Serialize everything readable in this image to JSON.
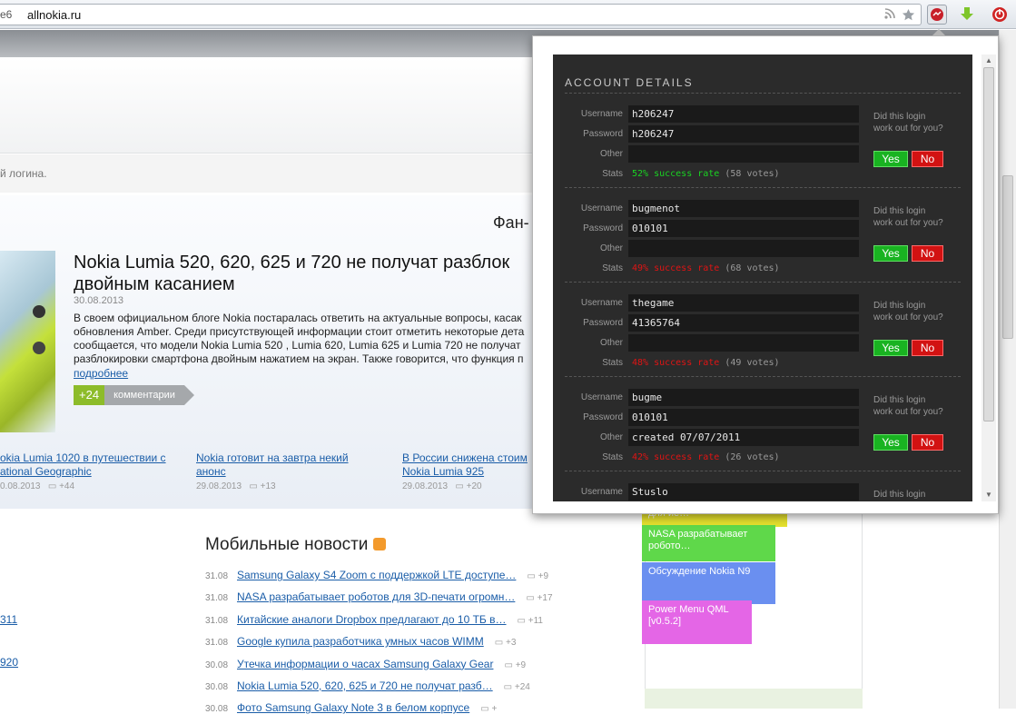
{
  "browser": {
    "tab_fragment": "е6",
    "url": "allnokia.ru",
    "icons": [
      "rss-icon",
      "star-icon",
      "account-extension-icon",
      "download-arrow-icon",
      "shutdown-icon"
    ]
  },
  "page": {
    "login_hint": "й логина.",
    "fan_heading": "Фан-",
    "feature": {
      "title_line1": "Nokia Lumia 520, 620, 625 и 720 не получат разблок",
      "title_line2": "двойным касанием",
      "date": "30.08.2013",
      "body_lines": [
        "В своем официальном блоге Nokia постаралась ответить на актуальные вопросы, касак",
        "обновления Amber. Среди присутствующей информации стоит отметить некоторые дета",
        "сообщается, что модели Nokia Lumia 520 , Lumia 620, Lumia 625 и Lumia 720 не получат",
        "разблокировки смартфона двойным нажатием на экран. Также говорится, что функция п"
      ],
      "more": "подробнее",
      "comments_count": "+24",
      "comments_label": "комментарии"
    },
    "sub_news": [
      {
        "title": "okia Lumia 1020 в путешествии с ational Geographic",
        "date": "0.08.2013",
        "comments": "+44"
      },
      {
        "title": "Nokia готовит на завтра некий анонс",
        "date": "29.08.2013",
        "comments": "+13"
      },
      {
        "title": "В России снижена стоим Nokia Lumia 925",
        "date": "29.08.2013",
        "comments": "+20"
      }
    ],
    "mobile_news_title": "Мобильные новости",
    "mobile_news": [
      {
        "date": "31.08",
        "title": "Samsung Galaxy S4 Zoom с поддержкой LTE доступе…",
        "comments": "+9"
      },
      {
        "date": "31.08",
        "title": "NASA разрабатывает роботов для 3D-печати огромн…",
        "comments": "+17"
      },
      {
        "date": "31.08",
        "title": "Китайские аналоги Dropbox предлагают до 10 ТБ в…",
        "comments": "+11"
      },
      {
        "date": "31.08",
        "title": "Google купила разработчика умных часов WIMM",
        "comments": "+3"
      },
      {
        "date": "30.08",
        "title": "Утечка информации о часах Samsung Galaxy Gear",
        "comments": "+9"
      },
      {
        "date": "30.08",
        "title": "Nokia Lumia 520, 620, 625 и 720 не получат разб…",
        "comments": "+24"
      },
      {
        "date": "30.08",
        "title": "Фото Samsung Galaxy Note 3 в белом корпусе",
        "comments": "+"
      }
    ],
    "left_links": [
      "311",
      "920"
    ],
    "tags": [
      {
        "text": "для ие…",
        "color": "#e6e22e"
      },
      {
        "text": "NASA разрабатывает робото…",
        "color": "#5fd84a"
      },
      {
        "text": "Обсуждение Nokia N9",
        "color": "#6a8ff0"
      },
      {
        "text": "Power Menu QML [v0.5.2]",
        "color": "#e466e6"
      }
    ]
  },
  "popup": {
    "title": "ACCOUNT DETAILS",
    "labels": {
      "username": "Username",
      "password": "Password",
      "other": "Other",
      "stats": "Stats"
    },
    "question": "Did this login work out for you?",
    "yes": "Yes",
    "no": "No",
    "accounts": [
      {
        "username": "h206247",
        "password": "h206247",
        "other": "",
        "rate": "52% success rate",
        "votes": "(58 votes)",
        "rate_color": "#19d322"
      },
      {
        "username": "bugmenot",
        "password": "010101",
        "other": "",
        "rate": "49% success rate",
        "votes": "(68 votes)",
        "rate_color": "#e01414"
      },
      {
        "username": "thegame",
        "password": "41365764",
        "other": "",
        "rate": "48% success rate",
        "votes": "(49 votes)",
        "rate_color": "#e01414"
      },
      {
        "username": "bugme",
        "password": "010101",
        "other": "created 07/07/2011",
        "rate": "42% success rate",
        "votes": "(26 votes)",
        "rate_color": "#e01414"
      },
      {
        "username": "Stuslo",
        "password": "",
        "other": "",
        "rate": "",
        "votes": "",
        "rate_color": "#e01414"
      }
    ]
  }
}
